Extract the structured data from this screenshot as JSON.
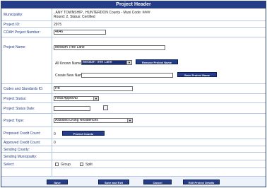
{
  "header": {
    "title": "Project Header"
  },
  "fields": {
    "municipality": {
      "label": "Municipality:",
      "line1": ", ANY TOWNSHIP , HUNTERDON County - Muni Code: ####",
      "line2": "Round: 2, Status: Certified"
    },
    "project_id": {
      "label": "Project ID:",
      "value": "2975"
    },
    "coah_number": {
      "label": "COAH Project Number:",
      "value": "4646"
    },
    "project_name": {
      "label": "Project Name:",
      "value": "Medium Tree Lane",
      "all_known_label": "All Known Names:",
      "all_known_selected": "Medium Tree Lane",
      "remove_button": "Remove Project Name",
      "create_label": "Create New Name:",
      "create_value": "",
      "save_name_button": "Save Project Name"
    },
    "codes_standards": {
      "label": "Codes and Standards ID:",
      "value": "PB"
    },
    "project_status": {
      "label": "Project Status:",
      "value": "Final Approval"
    },
    "project_status_date": {
      "label": "Project Status Date:",
      "value": ""
    },
    "project_type": {
      "label": "Project Type:",
      "value": "Assisted Living Residences"
    },
    "proposed_credit": {
      "label": "Proposed Credit Count:",
      "value": "0",
      "button": "Project Counts"
    },
    "approved_credit": {
      "label": "Approved Credit Count:",
      "value": "0"
    },
    "sending_county": {
      "label": "Sending County:"
    },
    "sending_municipality": {
      "label": "Sending Municipality:"
    },
    "select": {
      "label": "Select:",
      "group": "Group",
      "split": "Split"
    }
  },
  "footer": {
    "save": "Save",
    "save_exit": "Save and Exit",
    "cancel": "Cancel",
    "edit_details": "Edit Project Details"
  }
}
